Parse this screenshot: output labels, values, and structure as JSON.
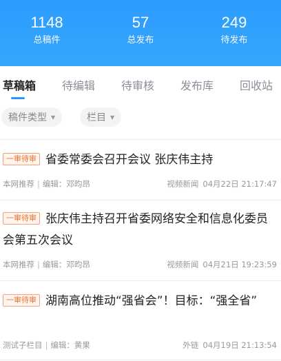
{
  "stats": [
    {
      "value": "1148",
      "label": "总稿件"
    },
    {
      "value": "57",
      "label": "总发布"
    },
    {
      "value": "249",
      "label": "待发布"
    }
  ],
  "tabs": [
    {
      "label": "草稿箱",
      "active": true
    },
    {
      "label": "待编辑",
      "active": false
    },
    {
      "label": "待审核",
      "active": false
    },
    {
      "label": "发布库",
      "active": false
    },
    {
      "label": "回收站",
      "active": false
    }
  ],
  "filters": [
    {
      "label": "稿件类型"
    },
    {
      "label": "栏目"
    }
  ],
  "articles": [
    {
      "badge": "一审待审",
      "title": "省委常委会召开会议 张庆伟主持",
      "column": "本网推荐",
      "editor": "编辑：邓昀昂",
      "source": "视频新闻",
      "time": "04月22日 21:17:47"
    },
    {
      "badge": "一审待审",
      "title": "张庆伟主持召开省委网络安全和信息化委员会第五次会议",
      "column": "本网推荐",
      "editor": "编辑：邓昀昂",
      "source": "视频新闻",
      "time": "04月21日 19:23:59"
    },
    {
      "badge": "一审待审",
      "title": "湖南高位推动“强省会”！目标：“强全省”",
      "column": "测试子栏目",
      "editor": "编辑：黄果",
      "source": "外链",
      "time": "04月19日 21:13:54"
    }
  ],
  "colors": {
    "header_blue": "#2b9cff",
    "badge_orange": "#f07430",
    "tab_indicator": "#2b95ff"
  }
}
